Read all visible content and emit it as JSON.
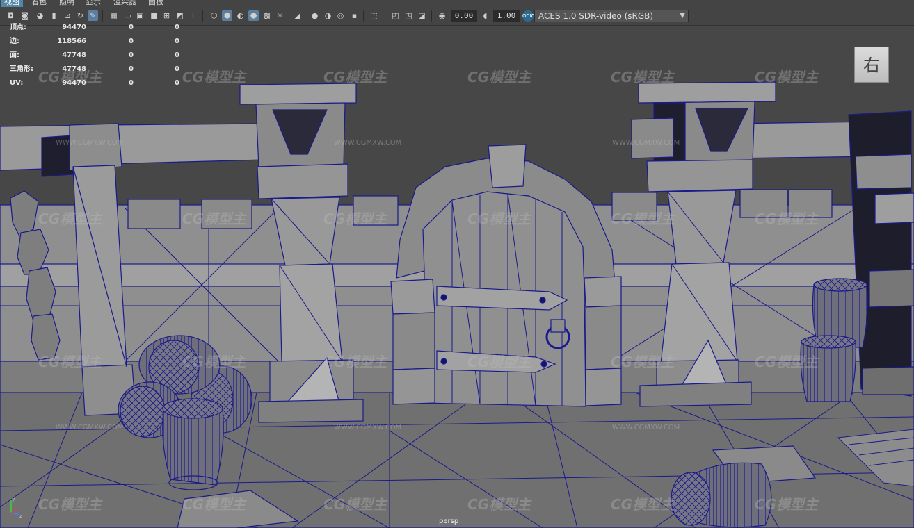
{
  "menu": {
    "items": [
      "视图",
      "着色",
      "照明",
      "显示",
      "渲染器",
      "面板"
    ],
    "active_index": 0
  },
  "toolbar": {
    "exposure_value": "0.00",
    "gamma_value": "1.00",
    "color_space": "ACES 1.0 SDR-video (sRGB)",
    "color_space_icon": "aces-icon"
  },
  "hud": {
    "rows": [
      {
        "label": "顶点:",
        "values": [
          "94470",
          "0",
          "0"
        ]
      },
      {
        "label": "边:",
        "values": [
          "118566",
          "0",
          "0"
        ]
      },
      {
        "label": "面:",
        "values": [
          "47748",
          "0",
          "0"
        ]
      },
      {
        "label": "三角形:",
        "values": [
          "47748",
          "0",
          "0"
        ]
      },
      {
        "label": "UV:",
        "values": [
          "94470",
          "0",
          "0"
        ]
      }
    ]
  },
  "viewport": {
    "camera_label": "persp",
    "viewcube_face": "右",
    "axis_labels": {
      "y": "y",
      "z": "z"
    },
    "background_color": "#474747",
    "wireframe_color": "#1a1a8c",
    "watermarks": [
      "CG模型主",
      "WWW.CGMXW.COM"
    ]
  }
}
